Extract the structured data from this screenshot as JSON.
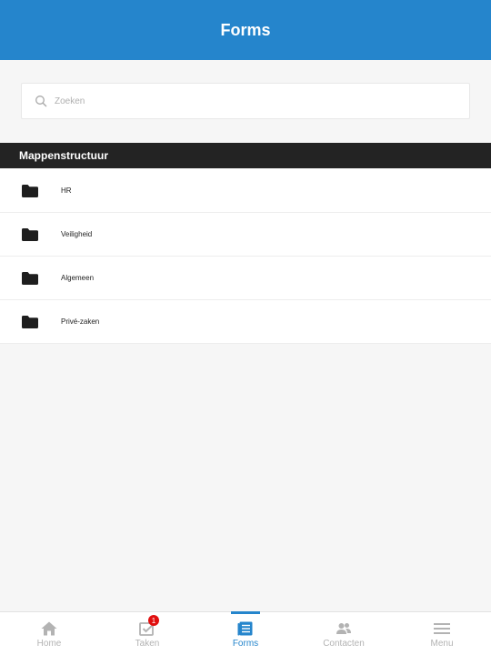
{
  "header": {
    "title": "Forms"
  },
  "search": {
    "placeholder": "Zoeken",
    "value": ""
  },
  "section": {
    "title": "Mappenstructuur"
  },
  "folders": [
    {
      "label": "HR",
      "icon": "folder-icon"
    },
    {
      "label": "Veiligheid",
      "icon": "folder-icon"
    },
    {
      "label": "Algemeen",
      "icon": "folder-icon"
    },
    {
      "label": "Privé-zaken",
      "icon": "folder-icon"
    }
  ],
  "tabbar": {
    "items": [
      {
        "label": "Home",
        "icon": "home-icon"
      },
      {
        "label": "Taken",
        "icon": "task-check-icon",
        "badge": "1"
      },
      {
        "label": "Forms",
        "icon": "forms-icon",
        "active": true
      },
      {
        "label": "Contacten",
        "icon": "contacts-icon"
      },
      {
        "label": "Menu",
        "icon": "hamburger-icon"
      }
    ]
  },
  "colors": {
    "primary": "#2585cc",
    "section_bar": "#232323",
    "badge": "#e10f0f",
    "background": "#f6f6f6"
  }
}
